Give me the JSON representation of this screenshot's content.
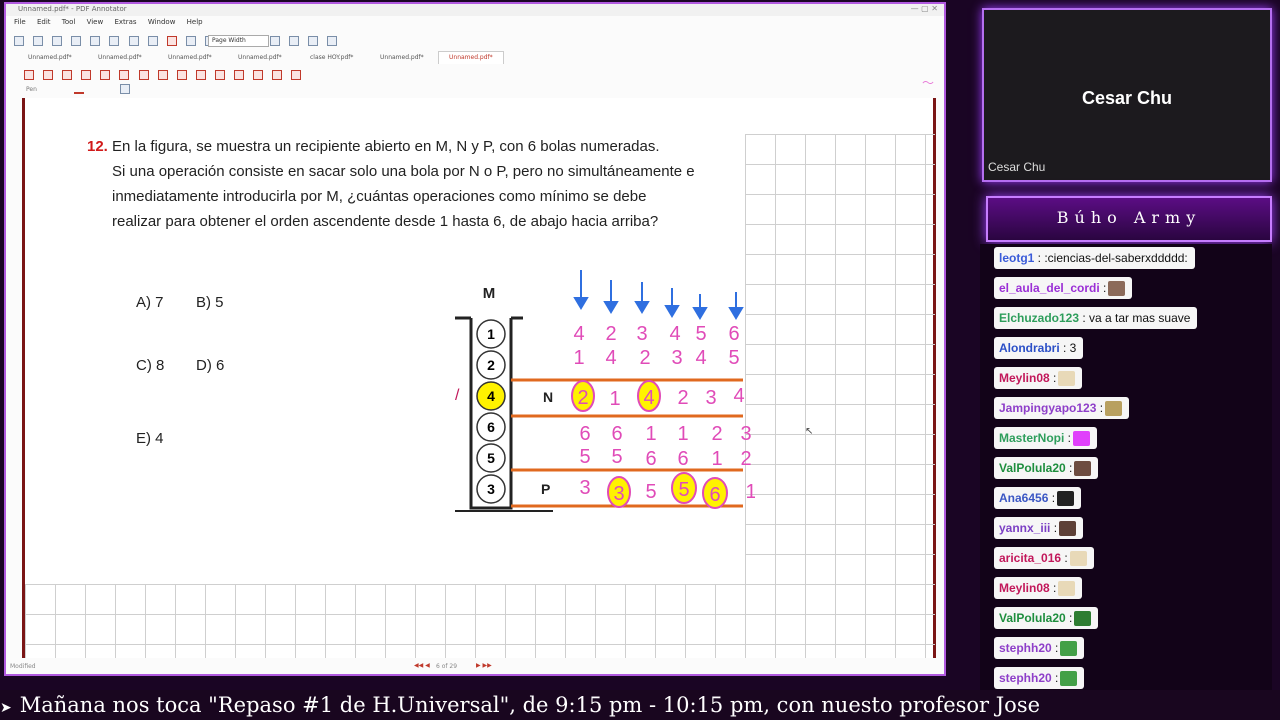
{
  "app": {
    "title": "Unnamed.pdf* - PDF Annotator",
    "menu": [
      "File",
      "Edit",
      "Tool",
      "View",
      "Extras",
      "Window",
      "Help"
    ],
    "zoom": "Page Width",
    "tabs": [
      "Unnamed.pdf*",
      "Unnamed.pdf*",
      "Unnamed.pdf*",
      "Unnamed.pdf*",
      "clase HOY.pdf*",
      "Unnamed.pdf*",
      "Unnamed.pdf*"
    ],
    "active_tab": 6,
    "tool_label": "Pen",
    "status_left": "Modified",
    "page_indicator": "6 of 29"
  },
  "question": {
    "number": "12.",
    "lines": [
      "En la figura, se muestra un recipiente abierto en M, N y P, con 6 bolas numeradas.",
      "Si una operación consiste en sacar solo una bola por N o P, pero no simultáneamente e",
      "inmediatamente introducirla por M, ¿cuántas operaciones como mínimo se debe",
      "realizar para obtener el orden ascendente desde 1 hasta 6, de abajo hacia arriba?"
    ],
    "options": [
      {
        "label": "A) 7"
      },
      {
        "label": "B) 5"
      },
      {
        "label": "C) 8"
      },
      {
        "label": "D) 6"
      },
      {
        "label": "E) 4"
      }
    ]
  },
  "figure": {
    "label_m": "M",
    "label_n": "N",
    "label_p": "P",
    "balls": [
      "1",
      "2",
      "4",
      "6",
      "5",
      "3"
    ],
    "mark": "/",
    "rows": [
      [
        "4",
        "2",
        "3",
        "4",
        "5",
        "6"
      ],
      [
        "1",
        "4",
        "2",
        "3",
        "4",
        "5"
      ],
      [
        "2",
        "1",
        "4",
        "2",
        "3",
        "4"
      ],
      [
        "6",
        "6",
        "1",
        "1",
        "2",
        "3"
      ],
      [
        "5",
        "5",
        "6",
        "6",
        "1",
        "2"
      ],
      [
        "3",
        "3",
        "5",
        "5",
        "6",
        "1"
      ]
    ]
  },
  "webcam": {
    "name": "Cesar Chu",
    "label": "Cesar Chu"
  },
  "chat": {
    "title": "Búho Army",
    "messages": [
      {
        "user": "leotg1",
        "text": " : :ciencias-del-saberxddddd:",
        "color": "#3a5bd9"
      },
      {
        "user": "el_aula_del_cordi",
        "text": " :",
        "color": "#9b2fd6",
        "emote": "#8b6a5a"
      },
      {
        "user": "Elchuzado123",
        "text": " : va a tar mas suave",
        "color": "#2e9e5c"
      },
      {
        "user": "Alondrabri",
        "text": " : 3",
        "color": "#2b4fc7"
      },
      {
        "user": "Meylin08",
        "text": " :",
        "color": "#c2185b",
        "emote": "#e8d9b8"
      },
      {
        "user": "Jampingyapo123",
        "text": " :",
        "color": "#8e3fc9",
        "emote": "#b8a060"
      },
      {
        "user": "MasterNopi",
        "text": " :",
        "color": "#2e9e5c",
        "emote": "#e040fb"
      },
      {
        "user": "ValPolula20",
        "text": " :",
        "color": "#1e8e3e",
        "emote": "#6d4c41"
      },
      {
        "user": "Ana6456",
        "text": " :",
        "color": "#3b57c4",
        "emote": "#222222"
      },
      {
        "user": "yannx_iii",
        "text": " :",
        "color": "#7b3fc4",
        "emote": "#5d4037"
      },
      {
        "user": "aricita_016",
        "text": " :",
        "color": "#c2185b",
        "emote": "#e8d9b8"
      },
      {
        "user": "Meylin08",
        "text": " :",
        "color": "#c2185b",
        "emote": "#e8d9b8"
      },
      {
        "user": "ValPolula20",
        "text": " :",
        "color": "#1e8e3e",
        "emote": "#2e7d32"
      },
      {
        "user": "stephh20",
        "text": " :",
        "color": "#8e3fc9",
        "emote": "#43a047"
      },
      {
        "user": "stephh20",
        "text": " :",
        "color": "#8e3fc9",
        "emote": "#43a047"
      }
    ]
  },
  "ticker": {
    "text": "Mañana nos toca \"Repaso #1 de H.Universal\", de 9:15 pm - 10:15 pm, con nuesto profesor Jose"
  }
}
